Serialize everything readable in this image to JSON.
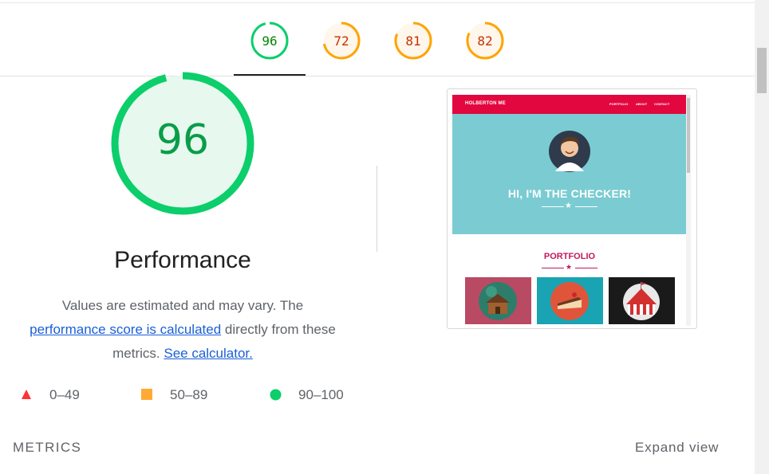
{
  "top_gauges": [
    {
      "label": "96",
      "value": 96,
      "color": "#0cce6b",
      "text_color": "#008800",
      "bg": "#ffffff"
    },
    {
      "label": "72",
      "value": 72,
      "color": "#ffa400",
      "text_color": "#c33300",
      "bg": "#fff6ec"
    },
    {
      "label": "81",
      "value": 81,
      "color": "#ffa400",
      "text_color": "#c33300",
      "bg": "#fff6ec"
    },
    {
      "label": "82",
      "value": 82,
      "color": "#ffa400",
      "text_color": "#c33300",
      "bg": "#fff6ec"
    }
  ],
  "main_gauge": {
    "score": "96",
    "value": 96,
    "color": "#0cce6b",
    "bg": "#e7f9ef"
  },
  "category": {
    "title": "Performance"
  },
  "description": {
    "text_before": "Values are estimated and may vary. The",
    "link_score": "performance score is calculated",
    "text_middle": "directly from these metrics.",
    "link_calculator": "See calculator."
  },
  "legend": [
    {
      "range": "0–49",
      "shape": "triangle",
      "color": "#ff3333"
    },
    {
      "range": "50–89",
      "shape": "square",
      "color": "#ffaa33"
    },
    {
      "range": "90–100",
      "shape": "circle",
      "color": "#0cce6b"
    }
  ],
  "thumbnail": {
    "brand": "HOLBERTON ME",
    "nav_links": [
      "PORTFOLIO",
      "ABOUT",
      "CONTACT"
    ],
    "hero_title": "HI, I'M THE CHECKER!",
    "section_title": "PORTFOLIO",
    "tiles": [
      {
        "name": "cabin",
        "color": "#b94a64"
      },
      {
        "name": "cake",
        "color": "#1aa3b3"
      },
      {
        "name": "circus",
        "color": "#1a1a1a"
      }
    ],
    "colors": {
      "nav": "#e2073f",
      "hero": "#7accd2",
      "accent": "#c2185b"
    }
  },
  "metrics_heading": "METRICS",
  "expand_label": "Expand view"
}
